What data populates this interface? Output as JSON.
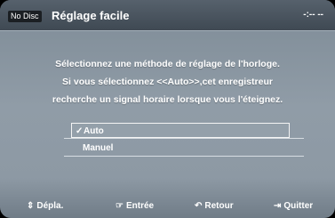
{
  "header": {
    "badge": "No Disc",
    "title": "Réglage facile",
    "clock": "-:-- --"
  },
  "message": {
    "line1": "Sélectionnez une méthode de réglage de l'horloge.",
    "line2": "Si vous sélectionnez <<Auto>>,cet enregistreur",
    "line3": "recherche un signal horaire lorsque vous l'éteignez."
  },
  "options": [
    {
      "label": "Auto",
      "selected": true,
      "check": "✓"
    },
    {
      "label": "Manuel",
      "selected": false
    }
  ],
  "footer": {
    "move": {
      "icon": "⇕",
      "label": "Dépla."
    },
    "enter": {
      "icon": "☞",
      "label": "Entrée"
    },
    "back": {
      "icon": "↶",
      "label": "Retour"
    },
    "exit": {
      "icon": "⇥",
      "label": "Quitter"
    }
  },
  "colors": {
    "header_bg": "#4b5560",
    "panel_bg": "#8e9aa5",
    "text": "#ffffff"
  }
}
